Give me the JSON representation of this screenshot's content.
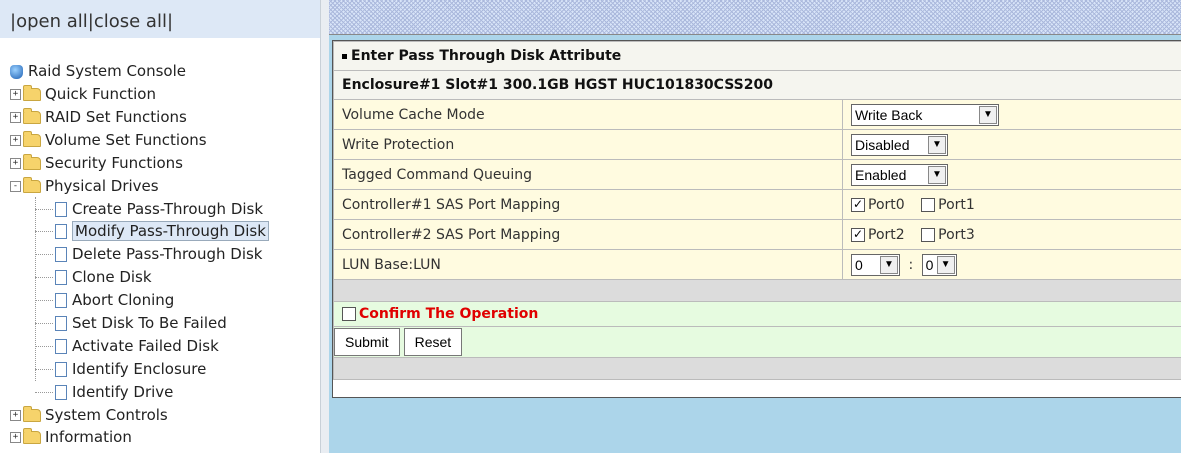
{
  "topbar": {
    "open_all": "open all",
    "close_all": "close all",
    "sep": "|"
  },
  "tree": {
    "root": "Raid System Console",
    "groups": [
      {
        "label": "Quick Function",
        "toggle": "+"
      },
      {
        "label": "RAID Set Functions",
        "toggle": "+"
      },
      {
        "label": "Volume Set Functions",
        "toggle": "+"
      },
      {
        "label": "Security Functions",
        "toggle": "+"
      },
      {
        "label": "Physical Drives",
        "toggle": "-"
      }
    ],
    "children": [
      "Create Pass-Through Disk",
      "Modify Pass-Through Disk",
      "Delete Pass-Through Disk",
      "Clone Disk",
      "Abort Cloning",
      "Set Disk To Be Failed",
      "Activate Failed Disk",
      "Identify Enclosure",
      "Identify Drive"
    ],
    "groups_after": [
      {
        "label": "System Controls",
        "toggle": "+"
      },
      {
        "label": "Information",
        "toggle": "+"
      }
    ]
  },
  "form": {
    "title": "Enter Pass Through Disk Attribute",
    "disk": "Enclosure#1 Slot#1 300.1GB HGST HUC101830CSS200",
    "rows": {
      "cache_label": "Volume Cache Mode",
      "cache_value": "Write Back",
      "write_label": "Write Protection",
      "write_value": "Disabled",
      "tcq_label": "Tagged Command Queuing",
      "tcq_value": "Enabled",
      "c1_label": "Controller#1 SAS Port Mapping",
      "c1_port0": "Port0",
      "c1_port1": "Port1",
      "c2_label": "Controller#2 SAS Port Mapping",
      "c2_port2": "Port2",
      "c2_port3": "Port3",
      "lun_label": "LUN Base:LUN",
      "lun_base": "0",
      "lun_sep": ":",
      "lun_value": "0"
    },
    "confirm": "Confirm The Operation",
    "submit": "Submit",
    "reset": "Reset"
  },
  "colors": {
    "confirm_text": "#e00000",
    "selected_bg": "#dde8f6"
  }
}
